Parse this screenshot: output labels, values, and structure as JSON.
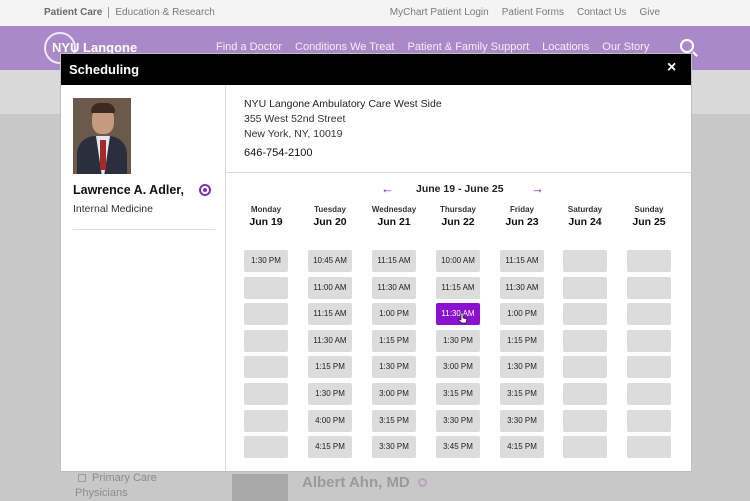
{
  "topbar": {
    "patient_care": "Patient Care",
    "education": "Education & Research",
    "links": [
      "MyChart Patient Login",
      "Patient Forms",
      "Contact Us",
      "Give"
    ]
  },
  "navbar": {
    "brand": "NYU Langone",
    "links": [
      "Find a Doctor",
      "Conditions We Treat",
      "Patient & Family Support",
      "Locations",
      "Our Story"
    ]
  },
  "background": {
    "filter_label": "Primary Care",
    "filter_label2": "Physicians",
    "next_doctor": "Albert Ahn, MD"
  },
  "modal": {
    "title": "Scheduling",
    "close_label": "×",
    "doctor": {
      "name": "Lawrence A. Adler,",
      "specialty": "Internal Medicine"
    },
    "location": {
      "name": "NYU Langone Ambulatory Care West Side",
      "street": "355 West 52nd Street",
      "city": "New York, NY, 10019",
      "phone": "646-754-2100"
    },
    "calendar": {
      "prev_icon": "←",
      "next_icon": "→",
      "range": "June 19  -  June 25",
      "days": [
        {
          "name": "Monday",
          "date": "Jun 19",
          "slots": [
            "1:30 PM",
            "",
            "",
            "",
            "",
            "",
            "",
            ""
          ]
        },
        {
          "name": "Tuesday",
          "date": "Jun 20",
          "slots": [
            "10:45 AM",
            "11:00 AM",
            "11:15 AM",
            "11:30 AM",
            "1:15 PM",
            "1:30 PM",
            "4:00 PM",
            "4:15 PM"
          ]
        },
        {
          "name": "Wednesday",
          "date": "Jun 21",
          "slots": [
            "11:15 AM",
            "11:30 AM",
            "1:00 PM",
            "1:15 PM",
            "1:30 PM",
            "3:00 PM",
            "3:15 PM",
            "3:30 PM"
          ]
        },
        {
          "name": "Thursday",
          "date": "Jun 22",
          "slots": [
            "10:00 AM",
            "11:15 AM",
            "11:30 AM",
            "1:30 PM",
            "3:00 PM",
            "3:15 PM",
            "3:30 PM",
            "3:45 PM"
          ]
        },
        {
          "name": "Friday",
          "date": "Jun 23",
          "slots": [
            "11:15 AM",
            "11:30 AM",
            "1:00 PM",
            "1:15 PM",
            "1:30 PM",
            "3:15 PM",
            "3:30 PM",
            "4:15 PM"
          ]
        },
        {
          "name": "Saturday",
          "date": "Jun 24",
          "slots": [
            "",
            "",
            "",
            "",
            "",
            "",
            "",
            ""
          ]
        },
        {
          "name": "Sunday",
          "date": "Jun 25",
          "slots": [
            "",
            "",
            "",
            "",
            "",
            "",
            "",
            ""
          ]
        }
      ],
      "selected": {
        "day": 3,
        "slot": 2
      }
    }
  },
  "colors": {
    "accent": "#8b10d0",
    "header_bg": "#000000",
    "nav_bg": "#ab89c9",
    "slot_bg": "#dcdcdc"
  }
}
